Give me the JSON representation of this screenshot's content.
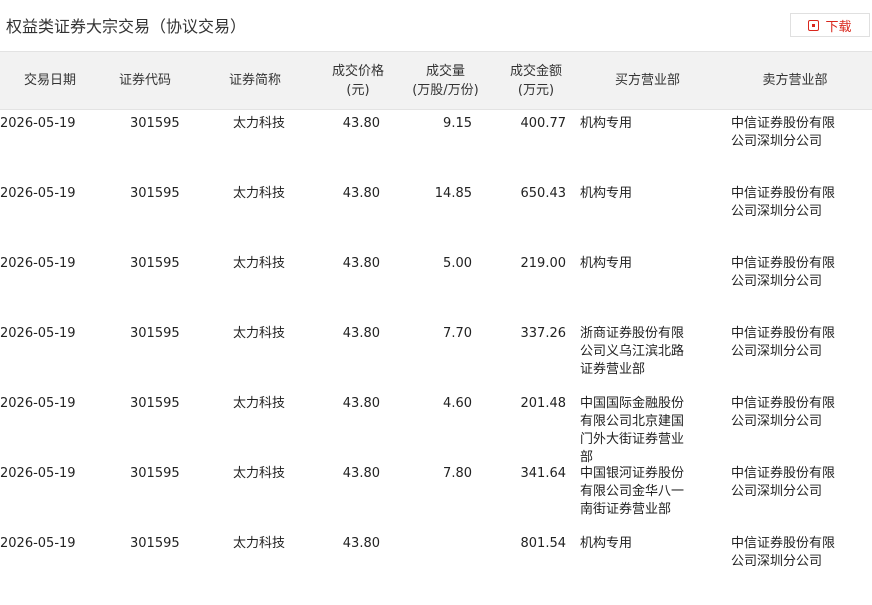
{
  "page": {
    "title": "权益类证券大宗交易（协议交易）",
    "download_label": "下载",
    "accent_color": "#d9261c"
  },
  "table": {
    "headers": [
      [
        "交易日期"
      ],
      [
        "证券代码"
      ],
      [
        "证券简称"
      ],
      [
        "成交价格",
        "(元)"
      ],
      [
        "成交量",
        "(万股/万份)"
      ],
      [
        "成交金额",
        "(万元)"
      ],
      [
        "买方营业部"
      ],
      [
        "卖方营业部"
      ]
    ],
    "rows": [
      {
        "date": "2026-05-19",
        "code": "301595",
        "name": "太力科技",
        "price": "43.80",
        "volume": "9.15",
        "amount": "400.77",
        "buyer": [
          "机构专用"
        ],
        "seller": [
          "中信证券股份有限",
          "公司深圳分公司"
        ]
      },
      {
        "date": "2026-05-19",
        "code": "301595",
        "name": "太力科技",
        "price": "43.80",
        "volume": "14.85",
        "amount": "650.43",
        "buyer": [
          "机构专用"
        ],
        "seller": [
          "中信证券股份有限",
          "公司深圳分公司"
        ]
      },
      {
        "date": "2026-05-19",
        "code": "301595",
        "name": "太力科技",
        "price": "43.80",
        "volume": "5.00",
        "amount": "219.00",
        "buyer": [
          "机构专用"
        ],
        "seller": [
          "中信证券股份有限",
          "公司深圳分公司"
        ]
      },
      {
        "date": "2026-05-19",
        "code": "301595",
        "name": "太力科技",
        "price": "43.80",
        "volume": "7.70",
        "amount": "337.26",
        "buyer": [
          "浙商证券股份有限",
          "公司义乌江滨北路",
          "证券营业部"
        ],
        "seller": [
          "中信证券股份有限",
          "公司深圳分公司"
        ]
      },
      {
        "date": "2026-05-19",
        "code": "301595",
        "name": "太力科技",
        "price": "43.80",
        "volume": "4.60",
        "amount": "201.48",
        "buyer": [
          "中国国际金融股份",
          "有限公司北京建国",
          "门外大街证券营业",
          "部"
        ],
        "seller": [
          "中信证券股份有限",
          "公司深圳分公司"
        ]
      },
      {
        "date": "2026-05-19",
        "code": "301595",
        "name": "太力科技",
        "price": "43.80",
        "volume": "7.80",
        "amount": "341.64",
        "buyer": [
          "中国银河证券股份",
          "有限公司金华八一",
          "南街证券营业部"
        ],
        "seller": [
          "中信证券股份有限",
          "公司深圳分公司"
        ]
      },
      {
        "date": "2026-05-19",
        "code": "301595",
        "name": "太力科技",
        "price": "43.80",
        "volume": "",
        "amount": "801.54",
        "buyer": [
          "机构专用"
        ],
        "seller": [
          "中信证券股份有限",
          "公司深圳分公司"
        ]
      }
    ]
  }
}
